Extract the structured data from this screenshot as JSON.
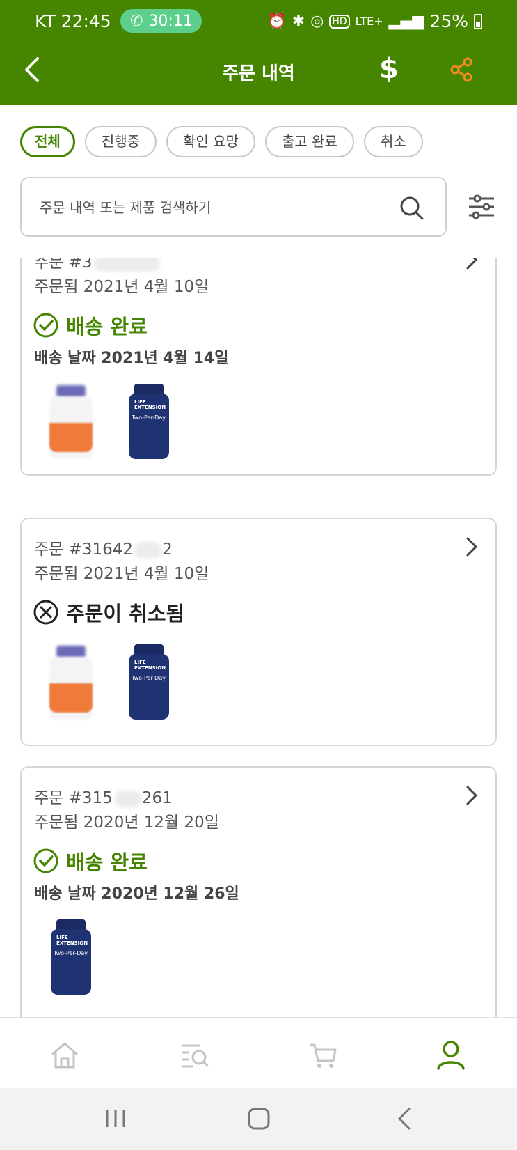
{
  "status_bar": {
    "carrier_time": "KT 22:45",
    "call_timer": "30:11",
    "network": "LTE+",
    "battery": "25%"
  },
  "appbar": {
    "title": "주문 내역",
    "dollar_symbol": "$",
    "accent_color": "#458500",
    "share_color": "#f28c1e"
  },
  "filters": {
    "chips": [
      "전체",
      "진행중",
      "확인 요망",
      "출고 완료",
      "취소"
    ],
    "active": "전체"
  },
  "search": {
    "placeholder": "주문 내역 또는 제품 검색하기"
  },
  "orders": [
    {
      "order_no": "주문 #3",
      "ordered_on": "주문됨 2021년 4월 10일",
      "status": "배송 완료",
      "status_type": "delivered",
      "shipped_on": "배송 날짜 2021년 4월 14일",
      "products": [
        "orange-bottle",
        "Two-Per-Day"
      ]
    },
    {
      "order_no": "주문 #31642",
      "order_no_suffix": "2",
      "ordered_on": "주문됨 2021년 4월 10일",
      "status": "주문이 취소됨",
      "status_type": "cancelled",
      "products": [
        "orange-bottle",
        "Two-Per-Day"
      ]
    },
    {
      "order_no": "주문 #315",
      "order_no_suffix": "261",
      "ordered_on": "주문됨 2020년 12월 20일",
      "status": "배송 완료",
      "status_type": "delivered",
      "shipped_on": "배송 날짜 2020년 12월 26일",
      "products": [
        "Two-Per-Day"
      ]
    }
  ],
  "product_label": {
    "brand": "LIFE EXTENSION",
    "name": "Two-Per-Day"
  },
  "bottom_nav": [
    "home-icon",
    "catalog-search-icon",
    "cart-icon",
    "account-icon"
  ]
}
